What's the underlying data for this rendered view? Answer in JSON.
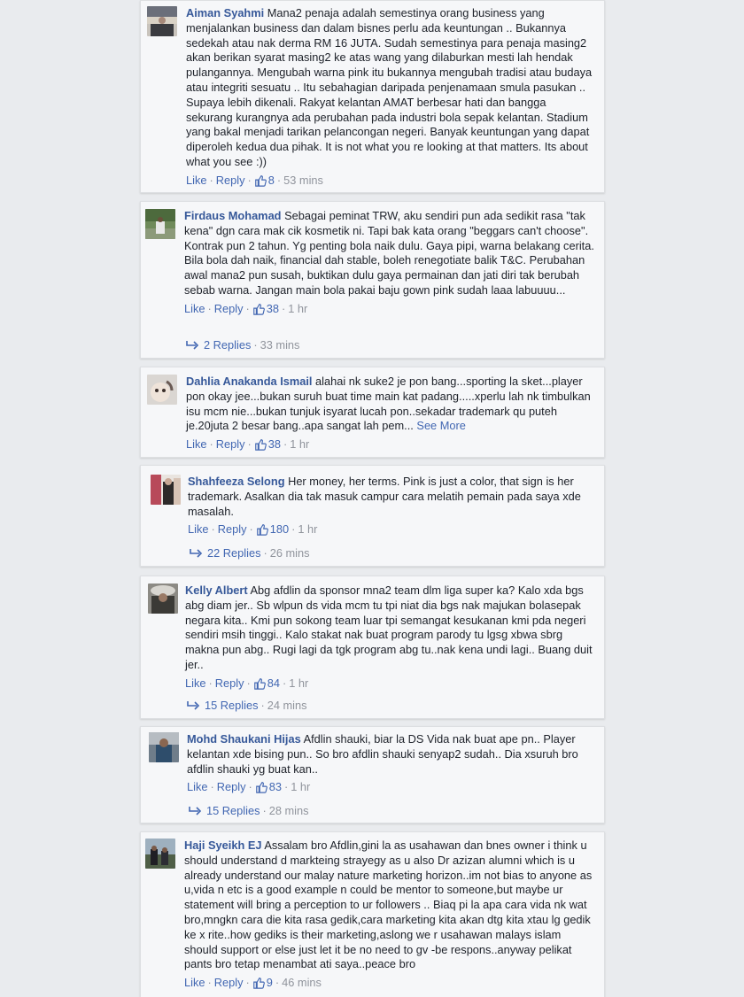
{
  "comments": [
    {
      "author": "Aiman Syahmi",
      "text": "Mana2 penaja adalah semestinya orang business yang menjalankan business dan dalam bisnes perlu ada keuntungan .. Bukannya sedekah atau nak derma RM 16 JUTA. Sudah semestinya para penaja masing2 akan berikan syarat masing2 ke atas wang yang dilaburkan mesti lah hendak pulangannya. Mengubah warna pink itu bukannya mengubah tradisi atau budaya atau integriti sesuatu .. Itu sebahagian daripada penjenamaan smula pasukan .. Supaya lebih dikenali. Rakyat kelantan AMAT berbesar hati dan bangga sekurang kurangnya ada perubahan pada industri bola sepak kelantan. Stadium yang bakal menjadi tarikan pelancongan negeri. Banyak keuntungan yang dapat diperoleh kedua dua pihak. It is not what you re looking at that matters. Its about what you see :))",
      "like_label": "Like",
      "reply_label": "Reply",
      "likes": "8",
      "time": "53 mins"
    },
    {
      "author": "Firdaus Mohamad",
      "text": "Sebagai peminat TRW, aku sendiri pun ada sedikit rasa \"tak kena\" dgn cara mak cik kosmetik ni. Tapi bak kata orang \"beggars can't choose\". Kontrak pun 2 tahun. Yg penting bola naik dulu. Gaya pipi, warna belakang cerita. Bila bola dah naik, financial dah stable, boleh renegotiate balik T&C. Perubahan awal mana2 pun susah, buktikan dulu gaya permainan dan jati diri tak berubah sebab warna. Jangan main bola pakai baju gown pink sudah laaa labuuuu...",
      "like_label": "Like",
      "reply_label": "Reply",
      "likes": "38",
      "time": "1 hr",
      "replies": "2 Replies",
      "replies_time": "33 mins"
    },
    {
      "author": "Dahlia Anakanda Ismail",
      "text": "alahai nk suke2 je pon bang...sporting la sket...player pon okay jee...bukan suruh buat time main kat padang.....xperlu lah nk timbulkan isu mcm nie...bukan tunjuk isyarat lucah pon..sekadar trademark qu puteh je.20juta 2 besar bang..apa sangat lah pem...",
      "see_more": "See More",
      "like_label": "Like",
      "reply_label": "Reply",
      "likes": "38",
      "time": "1 hr"
    },
    {
      "author": "Shahfeeza Selong",
      "text": "Her money, her terms. Pink is just a color, that sign is her trademark. Asalkan dia tak masuk campur cara melatih pemain pada saya xde masalah.",
      "like_label": "Like",
      "reply_label": "Reply",
      "likes": "180",
      "time": "1 hr",
      "replies": "22 Replies",
      "replies_time": "26 mins"
    },
    {
      "author": "Kelly Albert",
      "text": "Abg afdlin da sponsor mna2 team dlm liga super ka? Kalo xda bgs abg diam jer.. Sb wlpun ds vida mcm tu tpi niat dia bgs nak majukan bolasepak negara kita.. Kmi pun sokong team luar tpi semangat kesukanan kmi pda negeri sendiri msih tinggi.. Kalo stakat nak buat program parody tu lgsg xbwa sbrg makna pun abg.. Rugi lagi da tgk program abg tu..nak kena undi lagi.. Buang duit jer..",
      "like_label": "Like",
      "reply_label": "Reply",
      "likes": "84",
      "time": "1 hr",
      "replies": "15 Replies",
      "replies_time": "24 mins"
    },
    {
      "author": "Mohd Shaukani Hijas",
      "text": "Afdlin shauki, biar la DS Vida nak buat ape pn.. Player kelantan xde bising pun.. So bro afdlin shauki senyap2 sudah.. Dia xsuruh bro afdlin shauki yg buat kan..",
      "like_label": "Like",
      "reply_label": "Reply",
      "likes": "83",
      "time": "1 hr",
      "replies": "15 Replies",
      "replies_time": "28 mins"
    },
    {
      "author": "Haji Syeikh EJ",
      "text": "Assalam bro Afdlin,gini la as usahawan dan bnes owner i think u should understand d markteing strayegy as u also Dr azizan alumni which is u already understand our malay nature marketing horizon..im not bias to anyone as u,vida n etc is a good example n could be mentor to someone,but maybe ur statement will bring a perception to ur followers .. Biaq pi la apa cara vida nk wat bro,mngkn cara die kita rasa gedik,cara marketing kita akan dtg kita xtau lg gedik ke x rite..how gediks is their marketing,aslong we r usahawan malays islam should support or else just let it be no need to gv -be respons..anyway pelikat pants bro tetap menambat ati saya..peace bro",
      "like_label": "Like",
      "reply_label": "Reply",
      "likes": "9",
      "time": "46 mins"
    }
  ],
  "icons": {
    "thumb": "thumbs-up-icon",
    "reply_arrow": "reply-arrow-icon"
  },
  "colors": {
    "link": "#365899",
    "action": "#4267b2",
    "meta": "#90949c",
    "card_bg": "#f6f7f9",
    "page_bg": "#e9ebee"
  }
}
